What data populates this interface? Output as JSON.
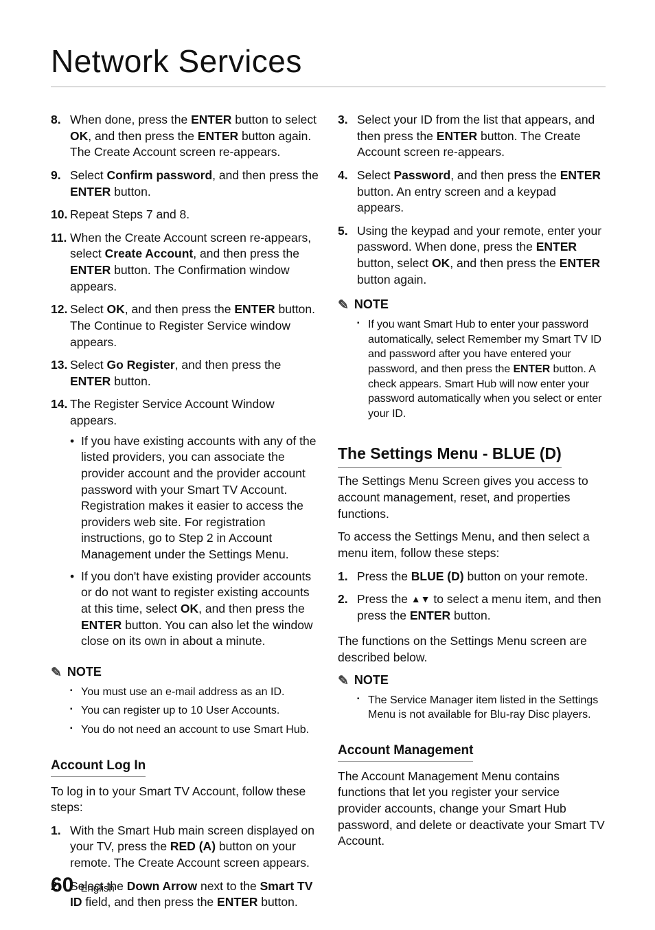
{
  "title": "Network Services",
  "left": {
    "list": [
      {
        "n": "8.",
        "pre": "When done, press the ",
        "b1": "ENTER",
        "mid1": " button to select ",
        "b2": "OK",
        "mid2": ", and then press the ",
        "b3": "ENTER",
        "post": " button again. The Create Account screen re-appears."
      },
      {
        "n": "9.",
        "pre": "Select ",
        "b1": "Confirm password",
        "mid1": ", and then press the ",
        "b2": "ENTER",
        "post": " button."
      },
      {
        "n": "10.",
        "txt": "Repeat Steps 7 and 8."
      },
      {
        "n": "11.",
        "pre": "When the Create Account screen re-appears, select ",
        "b1": "Create Account",
        "mid1": ", and then press the ",
        "b2": "ENTER",
        "post": " button. The Confirmation window appears."
      },
      {
        "n": "12.",
        "pre": "Select ",
        "b1": "OK",
        "mid1": ", and then press the ",
        "b2": "ENTER",
        "post": " button. The Continue to Register Service window appears."
      },
      {
        "n": "13.",
        "pre": "Select ",
        "b1": "Go Register",
        "mid1": ", and then press the ",
        "b2": "ENTER",
        "post": " button."
      },
      {
        "n": "14.",
        "txt": "The Register Service Account Window appears.",
        "sub": [
          "If you have existing accounts with any of the listed providers, you can associate the provider account and the provider account password with your Smart TV Account. Registration makes it easier to access the providers web site. For registration instructions, go to Step 2 in Account Management under the Settings Menu.",
          {
            "pre": "If you don't have existing provider accounts or do not want to register existing accounts at this time, select ",
            "b1": "OK",
            "mid1": ", and then press the ",
            "b2": "ENTER",
            "post": " button. You can also let the window close on its own in about a minute."
          }
        ]
      }
    ],
    "note_label": "NOTE",
    "notes": [
      "You must use an e-mail address as an ID.",
      "You can register up to 10 User Accounts.",
      "You do not need an account to use Smart Hub."
    ],
    "h3": "Account Log In",
    "p1": "To log in to your Smart TV Account, follow these steps:",
    "steps": [
      {
        "n": "1.",
        "pre": "With the Smart Hub main screen displayed on your TV, press the ",
        "b1": "RED (A)",
        "post": " button on your remote. The Create Account screen appears."
      },
      {
        "n": "2.",
        "pre": "Select the ",
        "b1": "Down Arrow",
        "mid1": " next to the ",
        "b2": "Smart TV ID",
        "mid2": " field, and then press the ",
        "b3": "ENTER",
        "post": " button."
      }
    ]
  },
  "right": {
    "list": [
      {
        "n": "3.",
        "pre": "Select your ID from the list that appears, and then press the ",
        "b1": "ENTER",
        "post": " button. The Create Account screen re-appears."
      },
      {
        "n": "4.",
        "pre": "Select ",
        "b1": "Password",
        "mid1": ", and then press the ",
        "b2": "ENTER",
        "post": " button. An entry screen and a keypad appears."
      },
      {
        "n": "5.",
        "pre": "Using the keypad and your remote, enter your password. When done, press the ",
        "b1": "ENTER",
        "mid1": " button, select ",
        "b2": "OK",
        "mid2": ", and then press the ",
        "b3": "ENTER",
        "post": " button again."
      }
    ],
    "note_label": "NOTE",
    "note1": {
      "pre": "If you want Smart Hub to enter your password automatically, select Remember my Smart TV ID and password after you have entered your password, and then press the ",
      "b1": "ENTER",
      "post": " button. A check appears. Smart Hub will now enter your password automatically when you select or enter your ID."
    },
    "h2": "The Settings Menu - BLUE (D)",
    "p1": "The Settings Menu Screen gives you access to account management, reset, and properties functions.",
    "p2": "To access the Settings Menu, and then select a menu item, follow these steps:",
    "steps": [
      {
        "n": "1.",
        "pre": "Press the ",
        "b1": "BLUE (D)",
        "post": " button on your remote."
      },
      {
        "n": "2.",
        "pre": "Press the ",
        "arr": "▲▼",
        "mid1": " to select a menu item, and then press the ",
        "b1": "ENTER",
        "post": " button."
      }
    ],
    "p3": "The functions on the Settings Menu screen are described below.",
    "note2_label": "NOTE",
    "note2": "The Service Manager item listed in the Settings Menu is not available for Blu-ray Disc players.",
    "h3": "Account Management",
    "p4": "The Account Management Menu contains functions that let you register your service provider accounts, change your Smart Hub password, and delete or deactivate your Smart TV Account."
  },
  "footer": {
    "page": "60",
    "lang": "English"
  }
}
